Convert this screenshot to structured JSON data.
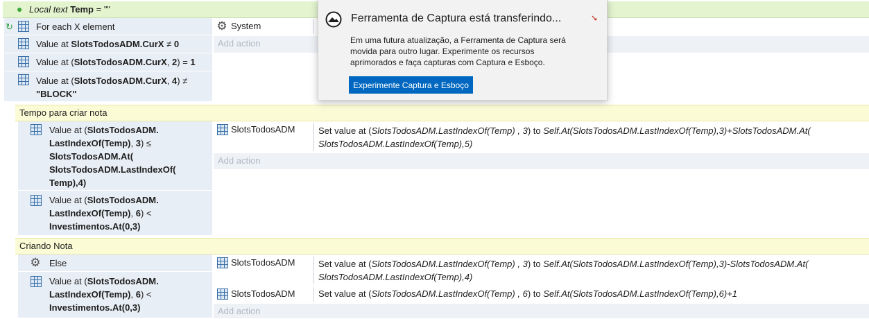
{
  "local_var": {
    "keyword": "Local text",
    "name": "Temp",
    "rest": " = \"\""
  },
  "event1": {
    "cond_for_each": "For each X element",
    "cond1": {
      "a": "Value at ",
      "b": "SlotsTodosADM.CurX",
      "c": " ≠ ",
      "d": "0"
    },
    "cond2": {
      "a": "Value at (",
      "b": "SlotsTodosADM.CurX",
      "c": ", ",
      "d": "2",
      "e": ") = ",
      "f": "1"
    },
    "cond3": {
      "a": "Value at (",
      "b": "SlotsTodosADM.CurX",
      "c": ", ",
      "d": "4",
      "e": ") ≠",
      "f": "\"BLOCK\""
    },
    "action_object": "System",
    "add_action": "Add action"
  },
  "group1": {
    "title": "Tempo para criar nota",
    "cond1": {
      "a": "Value at (",
      "l1": "SlotsTodosADM.",
      "l2": "LastIndexOf(Temp)",
      "l2b": ", ",
      "l2c": "3",
      "l2d": ") ≤",
      "l3": "SlotsTodosADM.At(",
      "l4": "SlotsTodosADM.LastIndexOf(",
      "l5": "Temp),4)"
    },
    "cond2": {
      "a": "Value at (",
      "l1": "SlotsTodosADM.",
      "l2": "LastIndexOf(Temp)",
      "l2b": ", ",
      "l2c": "6",
      "l2d": ") <",
      "l3": "Investimentos.At(0,3)"
    },
    "action_object": "SlotsTodosADM",
    "action_a": "Set value at (",
    "action_b": "SlotsTodosADM.LastIndexOf(Temp) , 3",
    "action_c": ") to ",
    "action_d": "Self.At(SlotsTodosADM.LastIndexOf(Temp),3)+SlotsTodosADM.At(",
    "action_e": "SlotsTodosADM.LastIndexOf(Temp),5)",
    "add_action": "Add action"
  },
  "group2": {
    "title": "Criando Nota",
    "else_label": "Else",
    "cond1": {
      "a": "Value at (",
      "l1": "SlotsTodosADM.",
      "l2": "LastIndexOf(Temp)",
      "l2b": ", ",
      "l2c": "6",
      "l2d": ") <",
      "l3": "Investimentos.At(0,3)"
    },
    "action1_object": "SlotsTodosADM",
    "action1_a": "Set value at (",
    "action1_b": "SlotsTodosADM.LastIndexOf(Temp) , 3",
    "action1_c": ") to ",
    "action1_d": "Self.At(SlotsTodosADM.LastIndexOf(Temp),3)-SlotsTodosADM.At(",
    "action1_e": "SlotsTodosADM.LastIndexOf(Temp),4)",
    "action2_object": "SlotsTodosADM",
    "action2_a": "Set value at (",
    "action2_b": "SlotsTodosADM.LastIndexOf(Temp) , 6",
    "action2_c": ") to ",
    "action2_d": "Self.At(SlotsTodosADM.LastIndexOf(Temp),6)+1",
    "add_action": "Add action"
  },
  "notification": {
    "title": "Ferramenta de Captura está transferindo...",
    "body": "Em uma futura atualização, a Ferramenta de Captura será movida para outro lugar. Experimente os recursos aprimorados e faça capturas com Captura e Esboço.",
    "button": "Experimente Captura e Esboço"
  },
  "colors": {
    "accent": "#0067c0",
    "variable_bg": "#e3f4cf",
    "group_bg": "#fbfbd5",
    "condition_bg": "#e8eef5"
  }
}
